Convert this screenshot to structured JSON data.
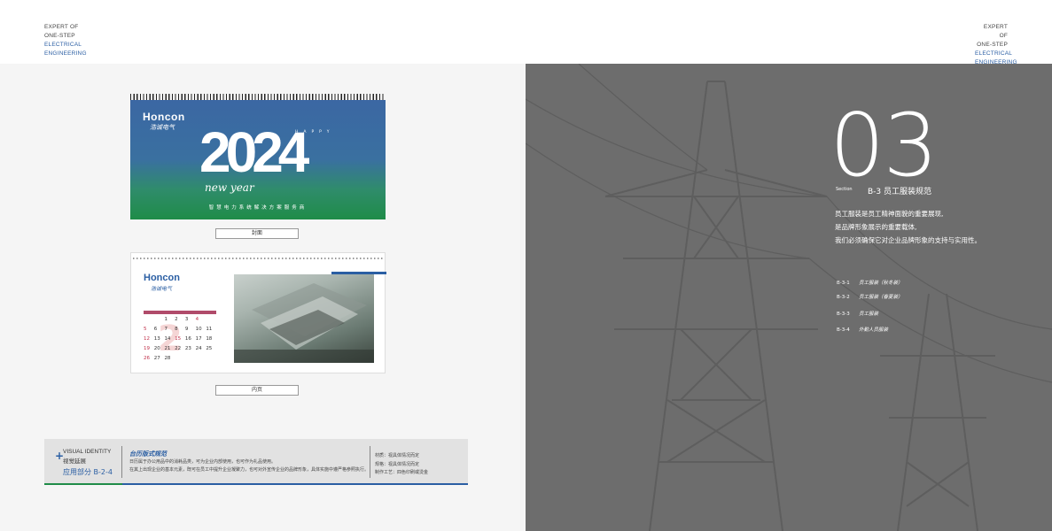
{
  "header": {
    "left_lines": [
      "EXPERT OF",
      "ONE-STEP",
      "ELECTRICAL",
      "ENGINEERING"
    ],
    "right_lines": [
      "EXPERT OF",
      "ONE-STEP",
      "ELECTRICAL",
      "ENGINEERING"
    ]
  },
  "cover": {
    "brand": "Honcon",
    "brand_cn": "浩诚电气",
    "happy": "HAPPY",
    "year": "2024",
    "new_year": "new year",
    "tagline": "智慧电力系统解决方案服务商",
    "caption": "封面"
  },
  "inner_page": {
    "brand": "Honcon",
    "brand_cn": "浩诚电气",
    "calendar_rows": [
      [
        "",
        "",
        "1",
        "2",
        "3",
        "4",
        ""
      ],
      [
        "5",
        "6",
        "7",
        "8",
        "9",
        "10",
        "11"
      ],
      [
        "12",
        "13",
        "14",
        "15",
        "16",
        "17",
        "18"
      ],
      [
        "19",
        "20",
        "21",
        "22",
        "23",
        "24",
        "25"
      ],
      [
        "26",
        "27",
        "28",
        "",
        "",
        "",
        ""
      ]
    ],
    "big_number": "2",
    "caption": "内页"
  },
  "info_box": {
    "vi_en": "VISUAL IDENTITY",
    "vi_cn": "视觉延展",
    "app_label": "应用部分 B-2-4",
    "title": "台历版式规范",
    "desc_line1": "日历属于办公用品中的消耗品类，可为企业内部使用，也可作为礼品使用。",
    "desc_line2": "在其上出现企业的基本元素，既可在员工中提升企业凝聚力，也可对外宣传企业的品牌形象，具体实施中遵严格参照执行。",
    "spec_material": "材质：视具体情况而定",
    "spec_size": "规格：视具体情况而定",
    "spec_process": "制作工艺：四色印刷或烫金"
  },
  "right": {
    "number": "03",
    "section_label": "Section",
    "section_title": "B-3  员工服装规范",
    "intro_line1": "员工服装是员工精神面貌的重要展现,",
    "intro_line2": "是品牌形象展示的重要载体,",
    "intro_line3": "我们必须确保它对企业品牌形象的支持与实用性。",
    "toc": [
      {
        "code": "B-3-1",
        "name": "员工服装（秋冬装）"
      },
      {
        "code": "B-3-2",
        "name": "员工服装（春夏装）"
      },
      {
        "code": "B-3-3",
        "name": "员工服装"
      },
      {
        "code": "B-3-4",
        "name": "外勤人员服装"
      }
    ]
  }
}
